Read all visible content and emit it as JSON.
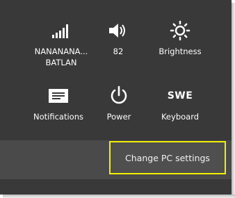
{
  "settings": {
    "tiles": [
      {
        "label": "NANANANA...\nBATLAN",
        "icon": "wifi-signal-icon"
      },
      {
        "label": "82",
        "icon": "speaker-volume-icon"
      },
      {
        "label": "Brightness",
        "icon": "sun-brightness-icon"
      },
      {
        "label": "Notifications",
        "icon": "notifications-icon"
      },
      {
        "label": "Power",
        "icon": "power-icon"
      },
      {
        "label": "Keyboard",
        "icon": "keyboard-language-icon",
        "icon_text": "SWE"
      }
    ],
    "change_pc_settings": "Change PC settings"
  },
  "colors": {
    "panel_background": "#393939",
    "band_background": "#4a4a4a",
    "highlight_border": "#f3f000",
    "text": "#ffffff"
  }
}
